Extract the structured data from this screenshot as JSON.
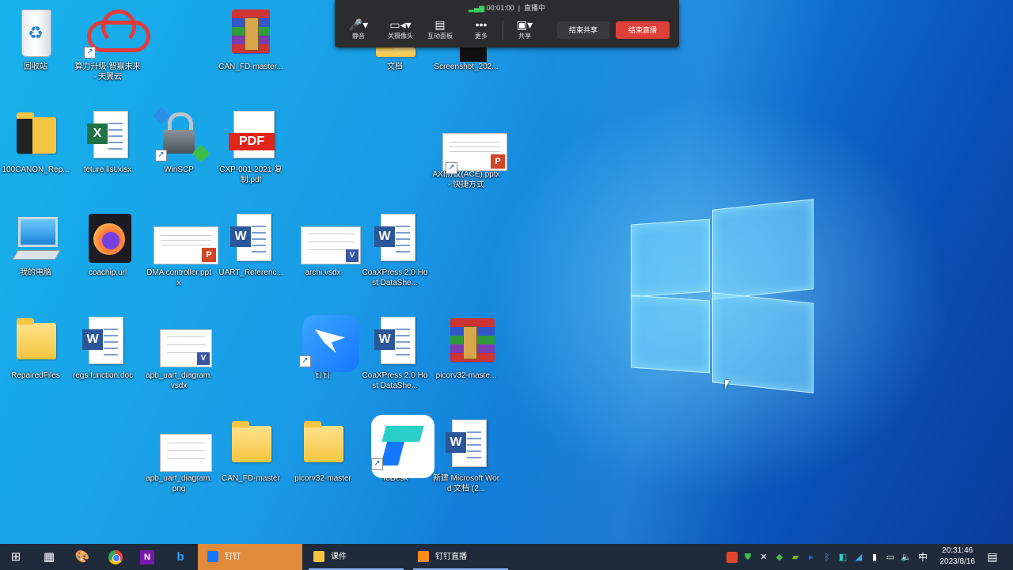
{
  "desktop_icons": [
    {
      "label": "回收站",
      "icon": "recycle-bin-icon"
    },
    {
      "label": "算力升级-智赢未来 - 天翼云",
      "icon": "cloud-icon"
    },
    {
      "label": "CAN_FD-master...",
      "icon": "winrar-archive-icon"
    },
    {
      "label": "文档",
      "icon": "folder-icon"
    },
    {
      "label": "Screenshot_202...",
      "icon": "image-file-icon"
    },
    {
      "label": "100CANON_Rep...",
      "icon": "folder-icon"
    },
    {
      "label": "feture list.xlsx",
      "icon": "excel-file-icon"
    },
    {
      "label": "WinSCP",
      "icon": "winscp-icon"
    },
    {
      "label": "CXP-001-2021-复制.pdf",
      "icon": "pdf-file-icon"
    },
    {
      "label": "AXI协议(ACE).pptx - 快捷方式",
      "icon": "powerpoint-file-icon"
    },
    {
      "label": "我的电脑",
      "icon": "computer-icon"
    },
    {
      "label": "coachip.url",
      "icon": "firefox-icon"
    },
    {
      "label": "DMA controller.pptx",
      "icon": "powerpoint-file-icon"
    },
    {
      "label": "UART_Referenc...",
      "icon": "word-file-icon"
    },
    {
      "label": "archi.vsdx",
      "icon": "visio-file-icon"
    },
    {
      "label": "CoaXPress 2.0 Host DataShe...",
      "icon": "word-file-icon"
    },
    {
      "label": "RepairedFiles",
      "icon": "folder-icon"
    },
    {
      "label": "regs.function.doc",
      "icon": "word-file-icon"
    },
    {
      "label": "apb_uart_diagram.vsdx",
      "icon": "visio-file-icon"
    },
    {
      "label": "钉钉",
      "icon": "dingtalk-icon"
    },
    {
      "label": "CoaXPress 2.0 Host DataShe...",
      "icon": "word-file-icon"
    },
    {
      "label": "picorv32-maste...",
      "icon": "winrar-archive-icon"
    },
    {
      "label": "apb_uart_diagram.png",
      "icon": "image-file-icon"
    },
    {
      "label": "CAN_FD-master",
      "icon": "folder-icon"
    },
    {
      "label": "picorv32-master",
      "icon": "folder-icon"
    },
    {
      "label": "ToDesk",
      "icon": "todesk-icon"
    },
    {
      "label": "新建 Microsoft Word 文档 (2...",
      "icon": "word-file-icon"
    }
  ],
  "meeting_bar": {
    "timer": "00:01:00",
    "status": "直播中",
    "buttons": [
      {
        "label": "静音",
        "icon": "microphone-icon"
      },
      {
        "label": "关摄像头",
        "icon": "camera-icon"
      },
      {
        "label": "互动面板",
        "icon": "panel-icon"
      },
      {
        "label": "更多",
        "icon": "more-icon"
      },
      {
        "label": "共享",
        "icon": "share-screen-icon"
      }
    ],
    "end_share": "结束共享",
    "end_live": "结束直播",
    "end_live_color": "#e0403a"
  },
  "taskbar": {
    "pinned": [
      "start-icon",
      "calculator-icon",
      "paint-icon",
      "chrome-icon",
      "onenote-icon",
      "bing-icon"
    ],
    "tasks": [
      {
        "label": "钉钉",
        "icon": "dingtalk-icon"
      },
      {
        "label": "课件",
        "icon": "folder-icon"
      },
      {
        "label": "钉钉直播",
        "icon": "dingtalk-live-icon"
      }
    ],
    "ime": "中",
    "clock": {
      "time": "20:31:46",
      "date": "2023/8/16"
    }
  }
}
